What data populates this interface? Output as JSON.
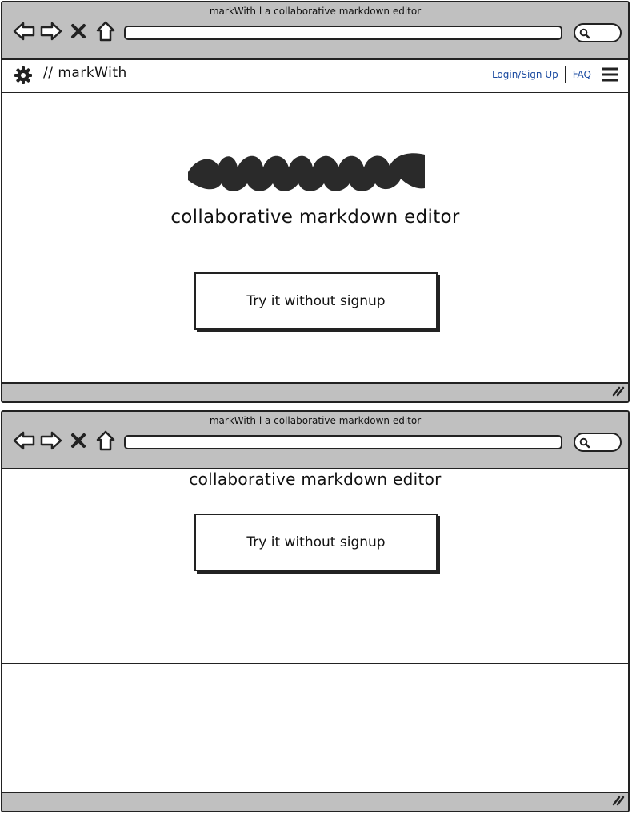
{
  "browser_top": {
    "window_title": "markWith l a collaborative markdown editor",
    "app_bar": {
      "brand": "// markWith",
      "login_link": "Login/Sign Up",
      "faq_link": "FAQ"
    },
    "tagline": "collaborative markdown editor",
    "cta_button": "Try it without signup"
  },
  "browser_bottom": {
    "window_title": "markWith l a collaborative markdown editor",
    "tagline": "collaborative markdown editor",
    "cta_button": "Try it without signup"
  },
  "icons": {
    "back": "back-arrow-icon",
    "forward": "forward-arrow-icon",
    "stop": "close-icon",
    "home": "home-icon",
    "search": "search-icon",
    "settings": "gear-icon",
    "menu": "hamburger-menu-icon",
    "resize": "resize-grip-icon"
  },
  "colors": {
    "chrome": "#c0c0c0",
    "border": "#222222",
    "link": "#1a4aa0"
  }
}
